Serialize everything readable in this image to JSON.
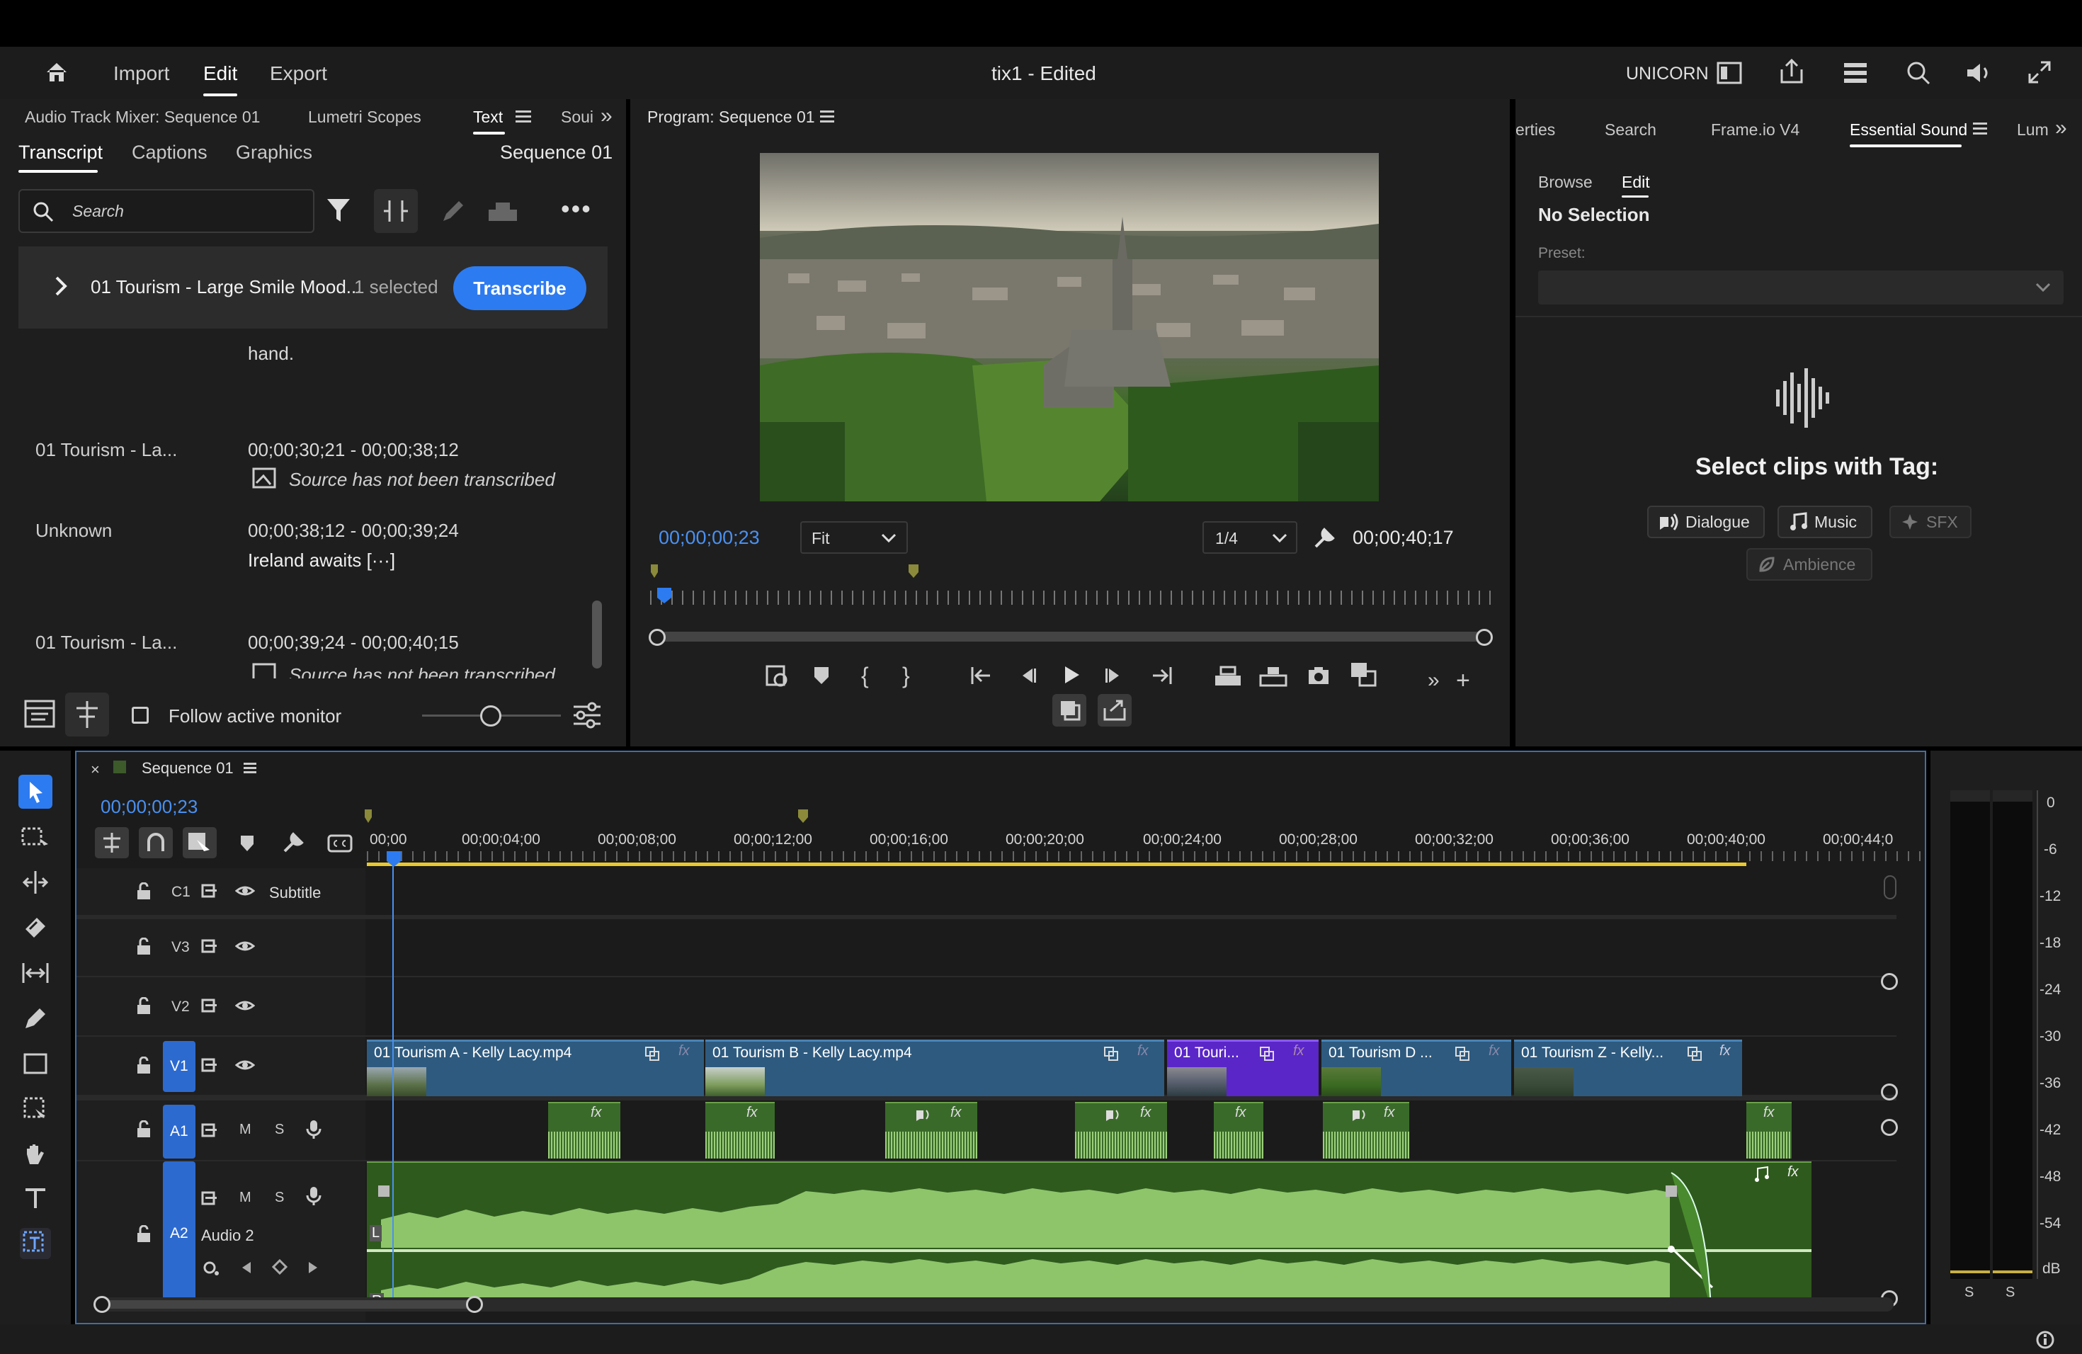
{
  "app": {
    "title": "tix1 - Edited",
    "workspace_badge": "UNICORN",
    "menu": {
      "import": "Import",
      "edit": "Edit",
      "export": "Export"
    }
  },
  "left_panel": {
    "tabs": [
      "Audio Track Mixer: Sequence 01",
      "Lumetri Scopes",
      "Text",
      "Soui"
    ],
    "subtabs": [
      "Transcript",
      "Captions",
      "Graphics"
    ],
    "sequence_name": "Sequence 01",
    "search_placeholder": "Search",
    "clip_row": {
      "name": "01 Tourism - Large Smile Mood...",
      "selected": "1 selected",
      "transcribe": "Transcribe"
    },
    "transcript_rows": [
      {
        "speaker": "",
        "time": "",
        "text": "hand."
      },
      {
        "speaker": "01 Tourism - La...",
        "time": "00;00;30;21 - 00;00;38;12",
        "text": "Source has not been transcribed"
      },
      {
        "speaker": "Unknown",
        "time": "00;00;38;12 - 00;00;39;24",
        "text": "Ireland awaits [···]"
      },
      {
        "speaker": "01 Tourism - La...",
        "time": "00;00;39;24 - 00;00;40;15",
        "text": "Source has not been transcribed"
      }
    ],
    "follow_monitor": "Follow active monitor"
  },
  "program_monitor": {
    "title": "Program: Sequence 01",
    "current_time": "00;00;00;23",
    "fit": "Fit",
    "resolution": "1/4",
    "duration": "00;00;40;17"
  },
  "right_panel": {
    "tabs": [
      "erties",
      "Search",
      "Frame.io V4",
      "Essential Sound",
      "Lum"
    ],
    "subtabs": [
      "Browse",
      "Edit"
    ],
    "no_selection": "No Selection",
    "preset_label": "Preset:",
    "select_clips": "Select clips with Tag:",
    "tags": [
      "Dialogue",
      "Music",
      "SFX",
      "Ambience"
    ]
  },
  "timeline": {
    "sequence": "Sequence 01",
    "current_time": "00;00;00;23",
    "ruler": [
      "00;00",
      "00;00;04;00",
      "00;00;08;00",
      "00;00;12;00",
      "00;00;16;00",
      "00;00;20;00",
      "00;00;24;00",
      "00;00;28;00",
      "00;00;32;00",
      "00;00;36;00",
      "00;00;40;00",
      "00;00;44;0"
    ],
    "tracks": {
      "c1": "C1",
      "c1_name": "Subtitle",
      "v3": "V3",
      "v2": "V2",
      "v1": "V1",
      "a1": "A1",
      "a2": "A2",
      "a2_name": "Audio 2",
      "m": "M",
      "s": "S"
    },
    "video_clips": [
      "01 Tourism A - Kelly Lacy.mp4",
      "01 Tourism B - Kelly Lacy.mp4",
      "01 Touri...",
      "01 Tourism D ...",
      "01 Tourism Z - Kelly..."
    ],
    "fx": "fx",
    "channel_l": "L",
    "channel_r": "R"
  },
  "meter": {
    "scale": [
      "0",
      "-6",
      "-12",
      "-18",
      "-24",
      "-30",
      "-36",
      "-42",
      "-48",
      "-54",
      "dB"
    ],
    "solo": [
      "S",
      "S"
    ]
  },
  "colors": {
    "accent": "#2d7bf0",
    "clip_blue": "#2e5a7f",
    "clip_purple": "#6a2fd0",
    "audio_green": "#3a6a2a",
    "timecode": "#4a90f0"
  }
}
